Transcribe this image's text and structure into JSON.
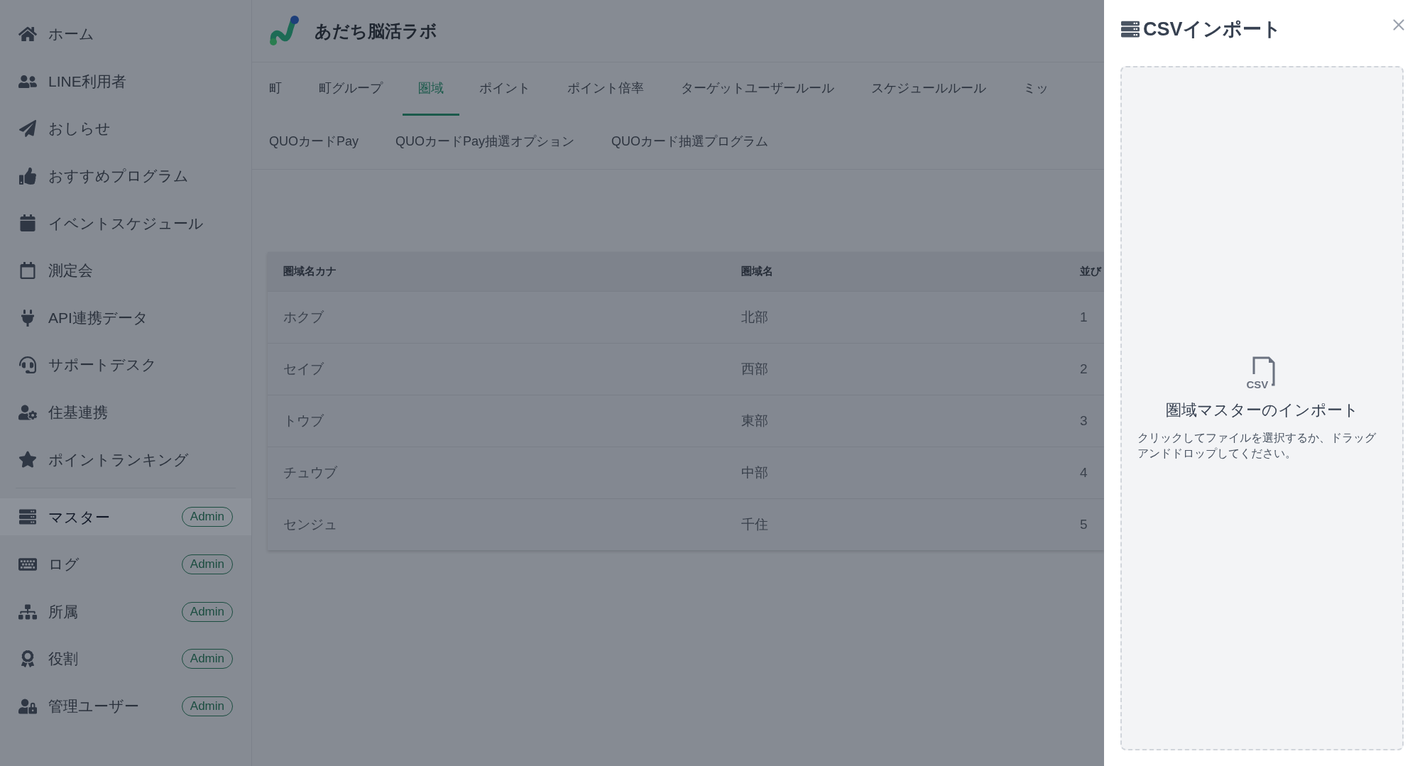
{
  "sidebar": {
    "items": [
      {
        "label": "ホーム",
        "selected": false
      },
      {
        "label": "LINE利用者",
        "selected": false
      },
      {
        "label": "おしらせ",
        "selected": false
      },
      {
        "label": "おすすめプログラム",
        "selected": false
      },
      {
        "label": "イベントスケジュール",
        "selected": false
      },
      {
        "label": "測定会",
        "selected": false
      },
      {
        "label": "API連携データ",
        "selected": false
      },
      {
        "label": "サポートデスク",
        "selected": false
      },
      {
        "label": "住基連携",
        "selected": false
      },
      {
        "label": "ポイントランキング",
        "selected": false
      }
    ],
    "admin_items": [
      {
        "label": "マスター",
        "badge": "Admin",
        "selected": true
      },
      {
        "label": "ログ",
        "badge": "Admin",
        "selected": false
      },
      {
        "label": "所属",
        "badge": "Admin",
        "selected": false
      },
      {
        "label": "役割",
        "badge": "Admin",
        "selected": false
      },
      {
        "label": "管理ユーザー",
        "badge": "Admin",
        "selected": false
      }
    ]
  },
  "header": {
    "app_name": "あだち脳活ラボ"
  },
  "tabs": [
    [
      {
        "label": "町",
        "selected": false
      },
      {
        "label": "町グループ",
        "selected": false
      },
      {
        "label": "圏域",
        "selected": true
      },
      {
        "label": "ポイント",
        "selected": false
      },
      {
        "label": "ポイント倍率",
        "selected": false
      },
      {
        "label": "ターゲットユーザールール",
        "selected": false
      },
      {
        "label": "スケジュールルール",
        "selected": false
      },
      {
        "label": "ミッ",
        "selected": false
      }
    ],
    [
      {
        "label": "QUOカードPay",
        "selected": false
      },
      {
        "label": "QUOカードPay抽選オプション",
        "selected": false
      },
      {
        "label": "QUOカード抽選プログラム",
        "selected": false
      }
    ]
  ],
  "table": {
    "columns": [
      "圏域名カナ",
      "圏域名",
      "並び"
    ],
    "rows": [
      [
        "ホクブ",
        "北部",
        "1"
      ],
      [
        "セイブ",
        "西部",
        "2"
      ],
      [
        "トウブ",
        "東部",
        "3"
      ],
      [
        "チュウブ",
        "中部",
        "4"
      ],
      [
        "センジュ",
        "千住",
        "5"
      ]
    ]
  },
  "drawer": {
    "title": "CSVインポート",
    "dropzone": {
      "file_label": "CSV",
      "title": "圏域マスターのインポート",
      "description": "クリックしてファイルを選択するか、ドラッグアンドドロップしてください。"
    }
  }
}
